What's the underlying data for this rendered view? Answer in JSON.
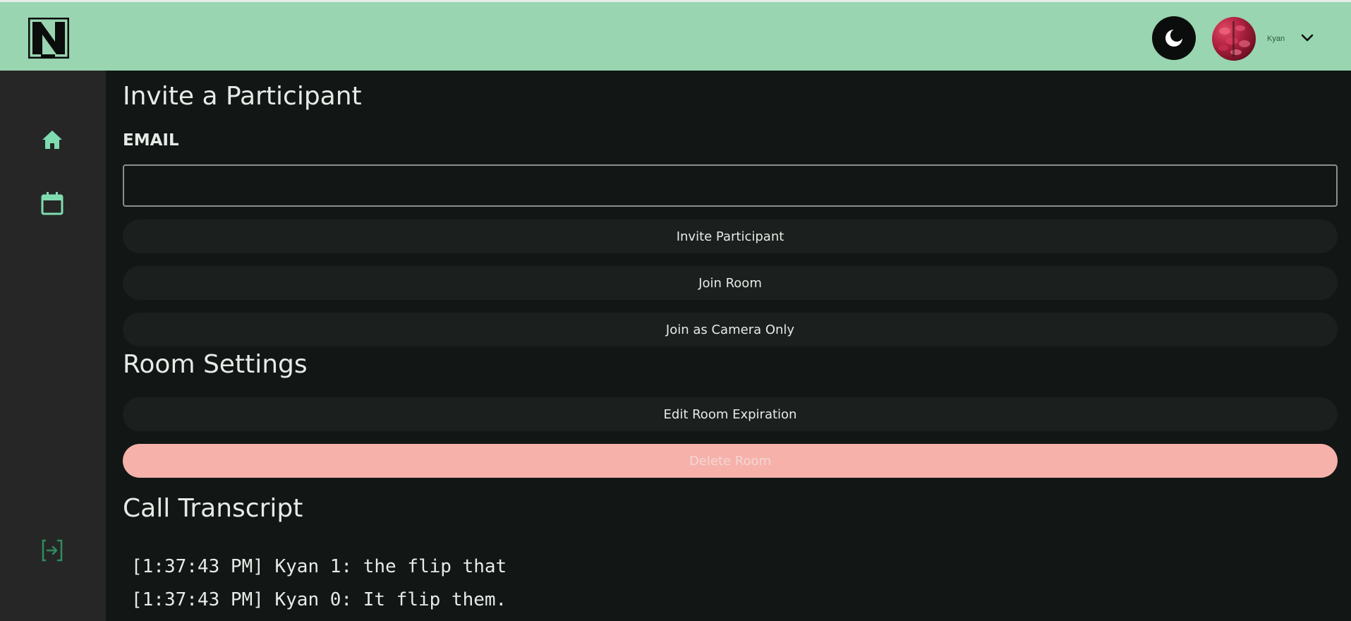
{
  "header": {
    "logo_icon": "n-logo-icon",
    "theme_toggle_icon": "moon-icon",
    "user_name": "Kyan",
    "menu_icon": "chevron-down-icon"
  },
  "sidebar": {
    "items": [
      {
        "icon": "home-icon"
      },
      {
        "icon": "calendar-icon"
      }
    ],
    "footer_icon": "logout-icon"
  },
  "invite": {
    "title": "Invite a Participant",
    "email_label": "EMAIL",
    "email_value": "",
    "invite_button": "Invite Participant",
    "join_button": "Join Room",
    "join_camera_button": "Join as Camera Only"
  },
  "room_settings": {
    "title": "Room Settings",
    "edit_expiration_button": "Edit Room Expiration",
    "delete_button": "Delete Room"
  },
  "transcript": {
    "title": "Call Transcript",
    "lines": [
      "[1:37:43 PM] Kyan 1: the flip that",
      "[1:37:43 PM] Kyan 0: It flip them."
    ]
  },
  "colors": {
    "header_bg": "#98d5b0",
    "sidebar_bg": "#262626",
    "main_bg": "#121614",
    "accent_icon": "#7fdcb0",
    "danger": "#f5b1aa"
  }
}
